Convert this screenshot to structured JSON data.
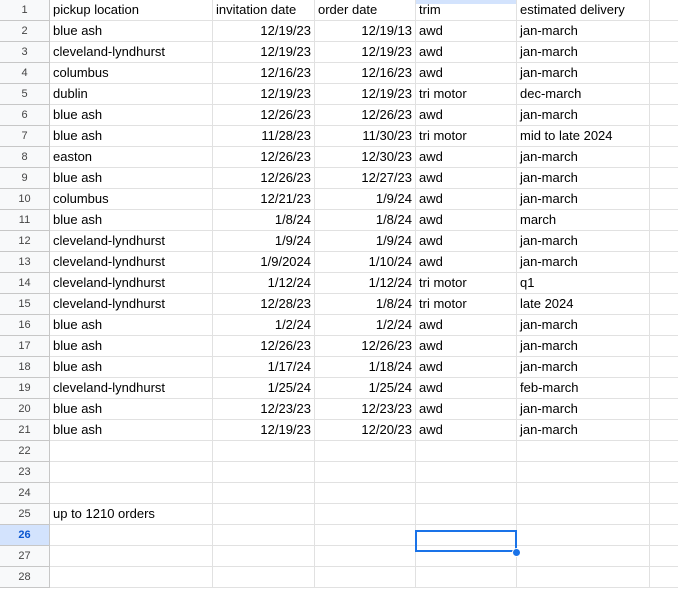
{
  "spreadsheet": {
    "active_cell": "D26",
    "rows": [
      {
        "num": "1",
        "cells": [
          "pickup location",
          "invitation date",
          "order date",
          "trim",
          "estimated delivery"
        ]
      },
      {
        "num": "2",
        "cells": [
          "blue ash",
          "12/19/23",
          "12/19/13",
          "awd",
          "jan-march"
        ]
      },
      {
        "num": "3",
        "cells": [
          "cleveland-lyndhurst",
          "12/19/23",
          "12/19/23",
          "awd",
          "jan-march"
        ]
      },
      {
        "num": "4",
        "cells": [
          "columbus",
          "12/16/23",
          "12/16/23",
          "awd",
          "jan-march"
        ]
      },
      {
        "num": "5",
        "cells": [
          "dublin",
          "12/19/23",
          "12/19/23",
          "tri motor",
          "dec-march"
        ]
      },
      {
        "num": "6",
        "cells": [
          "blue ash",
          "12/26/23",
          "12/26/23",
          "awd",
          "jan-march"
        ]
      },
      {
        "num": "7",
        "cells": [
          "blue ash",
          "11/28/23",
          "11/30/23",
          "tri motor",
          "mid to late 2024"
        ]
      },
      {
        "num": "8",
        "cells": [
          "easton",
          "12/26/23",
          "12/30/23",
          "awd",
          "jan-march"
        ]
      },
      {
        "num": "9",
        "cells": [
          "blue ash",
          "12/26/23",
          "12/27/23",
          "awd",
          "jan-march"
        ]
      },
      {
        "num": "10",
        "cells": [
          "columbus",
          "12/21/23",
          "1/9/24",
          "awd",
          "jan-march"
        ]
      },
      {
        "num": "11",
        "cells": [
          "blue ash",
          "1/8/24",
          "1/8/24",
          "awd",
          "march"
        ]
      },
      {
        "num": "12",
        "cells": [
          "cleveland-lyndhurst",
          "1/9/24",
          "1/9/24",
          "awd",
          "jan-march"
        ]
      },
      {
        "num": "13",
        "cells": [
          "cleveland-lyndhurst",
          "1/9/2024",
          "1/10/24",
          "awd",
          "jan-march"
        ]
      },
      {
        "num": "14",
        "cells": [
          "cleveland-lyndhurst",
          "1/12/24",
          "1/12/24",
          "tri motor",
          "q1"
        ]
      },
      {
        "num": "15",
        "cells": [
          "cleveland-lyndhurst",
          "12/28/23",
          "1/8/24",
          "tri motor",
          "late 2024"
        ]
      },
      {
        "num": "16",
        "cells": [
          "blue ash",
          "1/2/24",
          "1/2/24",
          "awd",
          "jan-march"
        ]
      },
      {
        "num": "17",
        "cells": [
          "blue ash",
          "12/26/23",
          "12/26/23",
          "awd",
          "jan-march"
        ]
      },
      {
        "num": "18",
        "cells": [
          "blue ash",
          "1/17/24",
          "1/18/24",
          "awd",
          "jan-march"
        ]
      },
      {
        "num": "19",
        "cells": [
          "cleveland-lyndhurst",
          "1/25/24",
          "1/25/24",
          "awd",
          "feb-march"
        ]
      },
      {
        "num": "20",
        "cells": [
          "blue ash",
          "12/23/23",
          "12/23/23",
          "awd",
          "jan-march"
        ]
      },
      {
        "num": "21",
        "cells": [
          "blue ash",
          "12/19/23",
          "12/20/23",
          "awd",
          "jan-march"
        ]
      },
      {
        "num": "22",
        "cells": [
          "",
          "",
          "",
          "",
          ""
        ]
      },
      {
        "num": "23",
        "cells": [
          "",
          "",
          "",
          "",
          ""
        ]
      },
      {
        "num": "24",
        "cells": [
          "",
          "",
          "",
          "",
          ""
        ]
      },
      {
        "num": "25",
        "cells": [
          "up to 1210 orders",
          "",
          "",
          "",
          ""
        ]
      },
      {
        "num": "26",
        "cells": [
          "",
          "",
          "",
          "",
          ""
        ]
      },
      {
        "num": "27",
        "cells": [
          "",
          "",
          "",
          "",
          ""
        ]
      },
      {
        "num": "28",
        "cells": [
          "",
          "",
          "",
          "",
          ""
        ]
      }
    ]
  }
}
